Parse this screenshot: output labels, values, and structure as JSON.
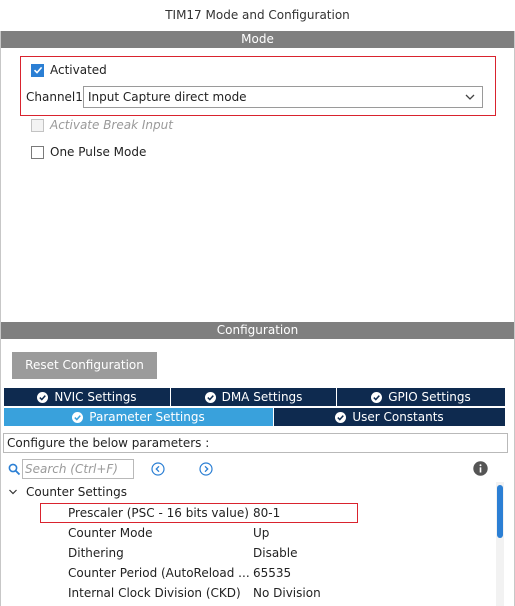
{
  "window": {
    "title": "TIM17 Mode and Configuration"
  },
  "mode": {
    "section_title": "Mode",
    "activated": {
      "label": "Activated",
      "checked": true
    },
    "channel1": {
      "label": "Channel1",
      "value": "Input Capture direct mode"
    },
    "break_input": {
      "label": "Activate Break Input",
      "checked": false,
      "enabled": false
    },
    "one_pulse": {
      "label": "One Pulse Mode",
      "checked": false
    }
  },
  "configuration": {
    "section_title": "Configuration",
    "reset_button": "Reset Configuration",
    "tabs_top": [
      {
        "label": "NVIC Settings"
      },
      {
        "label": "DMA Settings"
      },
      {
        "label": "GPIO Settings"
      }
    ],
    "tabs_bottom": [
      {
        "label": "Parameter Settings",
        "active": true
      },
      {
        "label": "User Constants",
        "active": false
      }
    ],
    "instruction": "Configure the below parameters :",
    "search": {
      "placeholder": "Search (Ctrl+F)"
    },
    "group": {
      "title": "Counter Settings"
    },
    "params": [
      {
        "name": "Prescaler (PSC - 16 bits value)",
        "value": "80-1"
      },
      {
        "name": "Counter Mode",
        "value": "Up"
      },
      {
        "name": "Dithering",
        "value": "Disable"
      },
      {
        "name": "Counter Period (AutoReload ...",
        "value": "65535"
      },
      {
        "name": "Internal Clock Division (CKD)",
        "value": "No Division"
      }
    ]
  },
  "colors": {
    "accent": "#39a1dc",
    "tab_dark": "#0e2a4f",
    "section_bar": "#7f7f7f",
    "highlight_box": "#d9232e",
    "check_blue": "#2b7fd4"
  },
  "icons": [
    "check-icon",
    "chevron-down-icon",
    "tab-check-icon",
    "search-icon",
    "nav-left-icon",
    "nav-right-icon",
    "info-icon",
    "collapse-arrow-icon"
  ]
}
